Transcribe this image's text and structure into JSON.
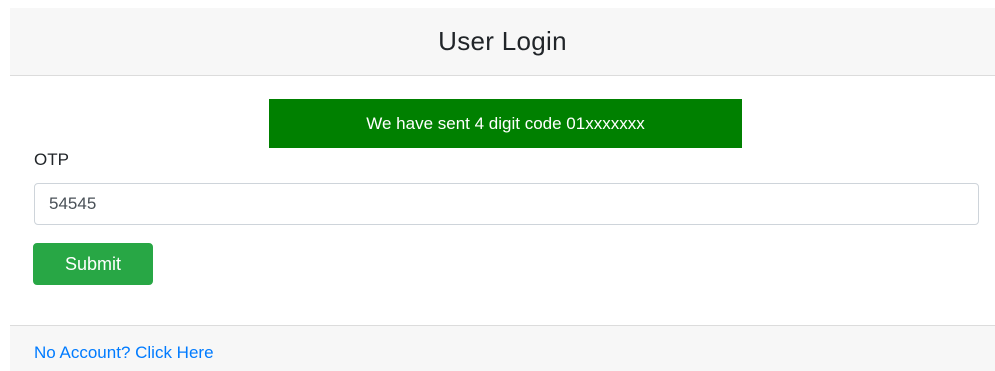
{
  "header": {
    "title": "User Login"
  },
  "alert": {
    "message": "We have sent 4 digit code 01xxxxxxx",
    "background_color": "#008000"
  },
  "form": {
    "otp_label": "OTP",
    "otp_value": "54545",
    "submit_label": "Submit",
    "submit_color": "#28a745"
  },
  "footer": {
    "link_text": "No Account? Click Here",
    "link_color": "#007bff"
  }
}
